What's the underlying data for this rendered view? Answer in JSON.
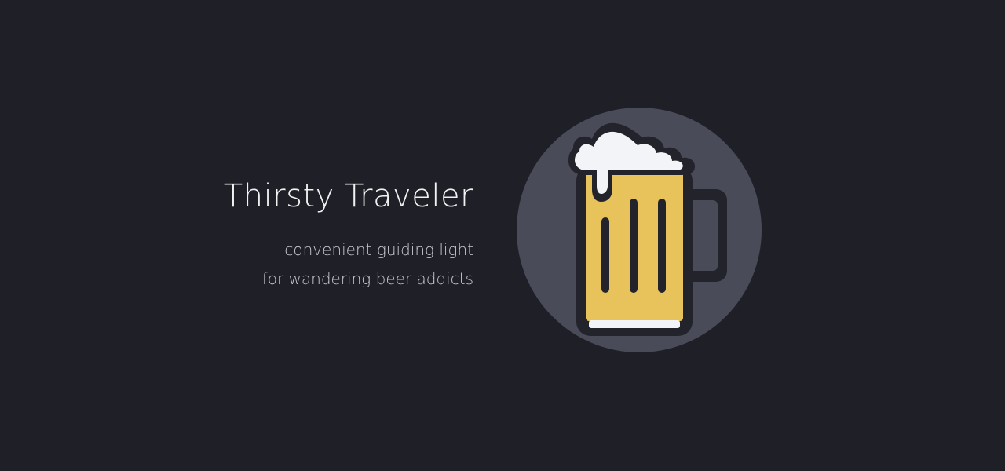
{
  "app": {
    "title": "Thirsty Traveler",
    "tagline_line1": "convenient guiding light",
    "tagline_line2": "for wandering beer addicts"
  },
  "logo": {
    "icon": "beer-mug-icon"
  },
  "colors": {
    "background": "#1f1f28",
    "circle": "#4a4b58",
    "outline": "#23232b",
    "beer": "#e8c25a",
    "foam": "#f3f4f8",
    "text": "#f2f2f2",
    "subtext": "#c8c8cf"
  }
}
